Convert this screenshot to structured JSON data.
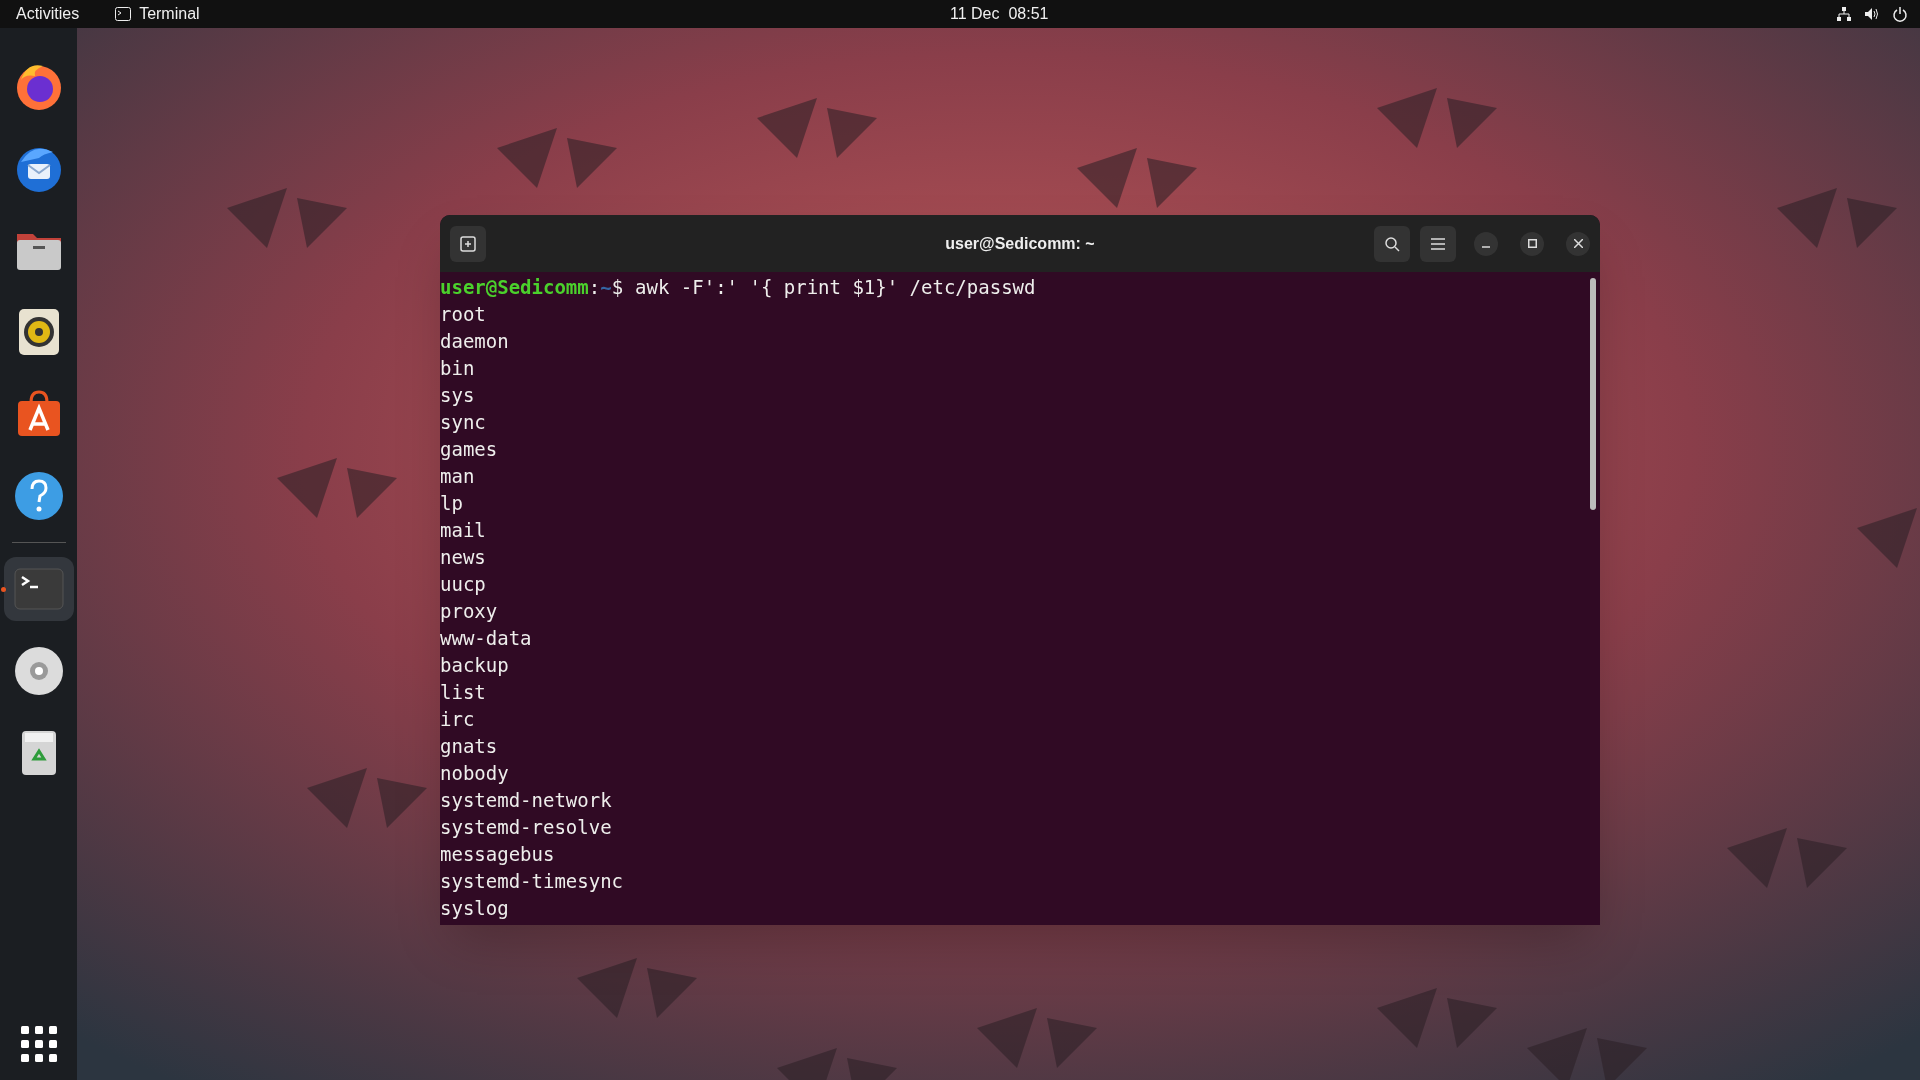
{
  "top_bar": {
    "activities": "Activities",
    "app_menu": "Terminal",
    "clock": "11 Dec  08:51"
  },
  "dock": {
    "items": [
      {
        "kind": "firefox",
        "running": false
      },
      {
        "kind": "thunderbird",
        "running": false
      },
      {
        "kind": "files",
        "running": false
      },
      {
        "kind": "rhythmbox",
        "running": false
      },
      {
        "kind": "appstore",
        "running": false
      },
      {
        "kind": "help",
        "running": false
      },
      {
        "kind": "separator"
      },
      {
        "kind": "terminal",
        "running": true
      },
      {
        "kind": "disc",
        "running": false
      },
      {
        "kind": "trash",
        "running": false
      }
    ]
  },
  "terminal": {
    "title": "user@Sedicomm: ~",
    "prompt": {
      "user_host": "user@Sedicomm",
      "separator": ":",
      "path": "~",
      "symbol": "$",
      "command": "awk -F':' '{ print $1}' /etc/passwd"
    },
    "output": [
      "root",
      "daemon",
      "bin",
      "sys",
      "sync",
      "games",
      "man",
      "lp",
      "mail",
      "news",
      "uucp",
      "proxy",
      "www-data",
      "backup",
      "list",
      "irc",
      "gnats",
      "nobody",
      "systemd-network",
      "systemd-resolve",
      "messagebus",
      "systemd-timesync",
      "syslog"
    ]
  }
}
